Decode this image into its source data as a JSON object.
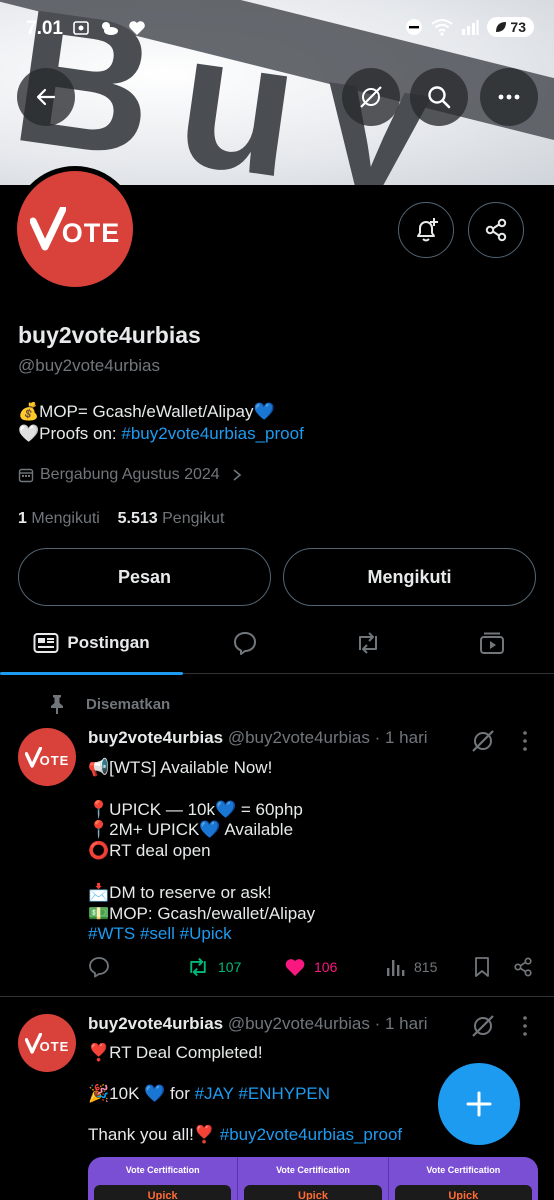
{
  "status_bar": {
    "time": "7.01",
    "battery": "73"
  },
  "banner": {
    "text": "Buy"
  },
  "profile": {
    "avatar_text": "VOTE",
    "name": "buy2vote4urbias",
    "handle": "@buy2vote4urbias",
    "bio_line1_prefix": "💰MOP= Gcash/eWallet/Alipay💙",
    "bio_line2_prefix": "🤍Proofs on: ",
    "bio_line2_link": "#buy2vote4urbias_proof",
    "joined": "Bergabung Agustus 2024",
    "following_count": "1",
    "following_label": "Mengikuti",
    "followers_count": "5.513",
    "followers_label": "Pengikut",
    "message_button": "Pesan",
    "following_button": "Mengikuti"
  },
  "tabs": [
    {
      "label": "Postingan",
      "icon": "posts-icon",
      "active": true
    },
    {
      "label": "",
      "icon": "replies-icon"
    },
    {
      "label": "",
      "icon": "retweet-icon"
    },
    {
      "label": "",
      "icon": "media-icon"
    }
  ],
  "pinned_label": "Disematkan",
  "posts": [
    {
      "author": "buy2vote4urbias",
      "handle": "@buy2vote4urbias",
      "time": "· 1 hari",
      "lines": [
        "📢[WTS] Available Now!",
        "",
        "📍UPICK — 10k💙 = 60php",
        "📍2M+ UPICK💙 Available",
        "⭕RT deal open",
        "",
        "📩DM to reserve or ask!",
        "💵MOP: Gcash/ewallet/Alipay"
      ],
      "hashtags": "#WTS #sell #Upick",
      "retweets": "107",
      "likes": "106",
      "views": "815"
    },
    {
      "author": "buy2vote4urbias",
      "handle": "@buy2vote4urbias",
      "time": "· 1 hari",
      "line1": "❣️RT Deal Completed!",
      "line2_prefix": "🎉10K 💙 for ",
      "line2_tags": "#JAY #ENHYPEN",
      "line3_prefix": "Thank you all!❣️ ",
      "line3_tag": "#buy2vote4urbias_proof",
      "cert_title": "Vote Certification",
      "cert_card": "Upick"
    }
  ],
  "colors": {
    "accent": "#1d9bf0",
    "avatar_red": "#d9423a",
    "like_pink": "#f91880",
    "retweet_green": "#00ba7c",
    "muted": "#71767b"
  }
}
